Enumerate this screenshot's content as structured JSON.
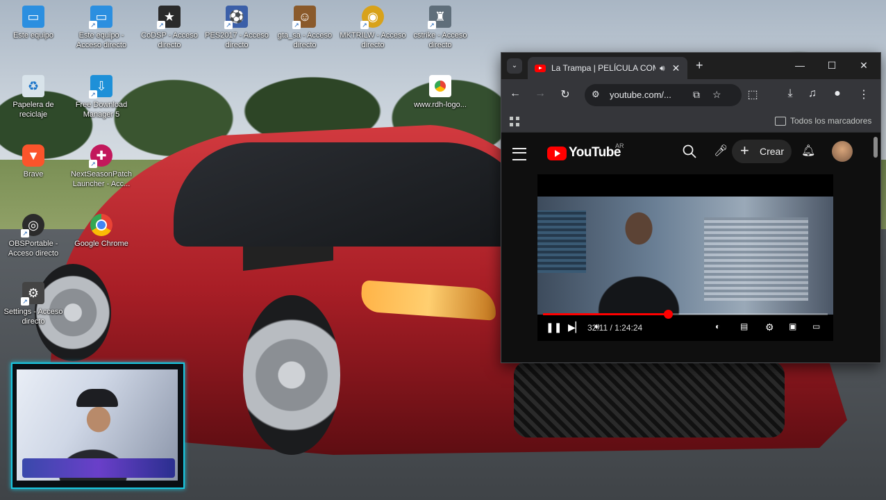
{
  "desktop": {
    "icons": [
      {
        "label": "Este equipo",
        "icon": "monitor-icon",
        "color": "#2b8fe0",
        "shortcut": false
      },
      {
        "label": "Este equipo - Acceso directo",
        "icon": "monitor-icon",
        "color": "#2b8fe0",
        "shortcut": true
      },
      {
        "label": "CoDSP - Acceso directo",
        "icon": "star-icon",
        "color": "#2a2a2a",
        "shortcut": true
      },
      {
        "label": "PES2017 - Acceso directo",
        "icon": "game-icon",
        "color": "#3b5fa8",
        "shortcut": true
      },
      {
        "label": "gta_sa - Acceso directo",
        "icon": "gta-icon",
        "color": "#8a5a2b",
        "shortcut": true
      },
      {
        "label": "MKTRILW - Acceso directo",
        "icon": "dragon-icon",
        "color": "#d8a21a",
        "shortcut": true
      },
      {
        "label": "cstrike - Acceso directo",
        "icon": "soldier-icon",
        "color": "#5f6e7a",
        "shortcut": true
      },
      {
        "label": "Papelera de reciclaje",
        "icon": "recycle-bin-icon",
        "color": "#d8e3ea",
        "shortcut": false
      },
      {
        "label": "Free Download Manager 5",
        "icon": "download-manager-icon",
        "color": "#1e90d8",
        "shortcut": true
      },
      {
        "label": "Brave",
        "icon": "brave-icon",
        "color": "#fb542b",
        "shortcut": false
      },
      {
        "label": "NextSeasonPatch Launcher - Acc...",
        "icon": "gamepad-icon",
        "color": "#c2185b",
        "shortcut": true
      },
      {
        "label": "OBSPortable - Acceso directo",
        "icon": "obs-icon",
        "color": "#2b2b2b",
        "shortcut": true
      },
      {
        "label": "Google Chrome",
        "icon": "chrome-icon",
        "color": "#4285f4",
        "shortcut": false
      },
      {
        "label": "Settings - Acceso directo",
        "icon": "settings-icon",
        "color": "#444",
        "shortcut": true
      },
      {
        "label": "www.rdh-logo...",
        "icon": "chrome-doc-icon",
        "color": "#ffffff",
        "shortcut": false
      }
    ]
  },
  "browser": {
    "tab_title": "La Trampa | PELÍCULA COMPLETA",
    "url": "youtube.com/...",
    "bookmarks_label": "Todos los marcadores",
    "colors": {
      "accent": "#ff0000",
      "frame": "#1f1f1f",
      "toolbar": "#35363a"
    }
  },
  "youtube": {
    "logo_text": "YouTube",
    "region": "AR",
    "create_label": "Crear",
    "player": {
      "time": "32:11 / 1:24:24",
      "progress": 0.44
    }
  }
}
